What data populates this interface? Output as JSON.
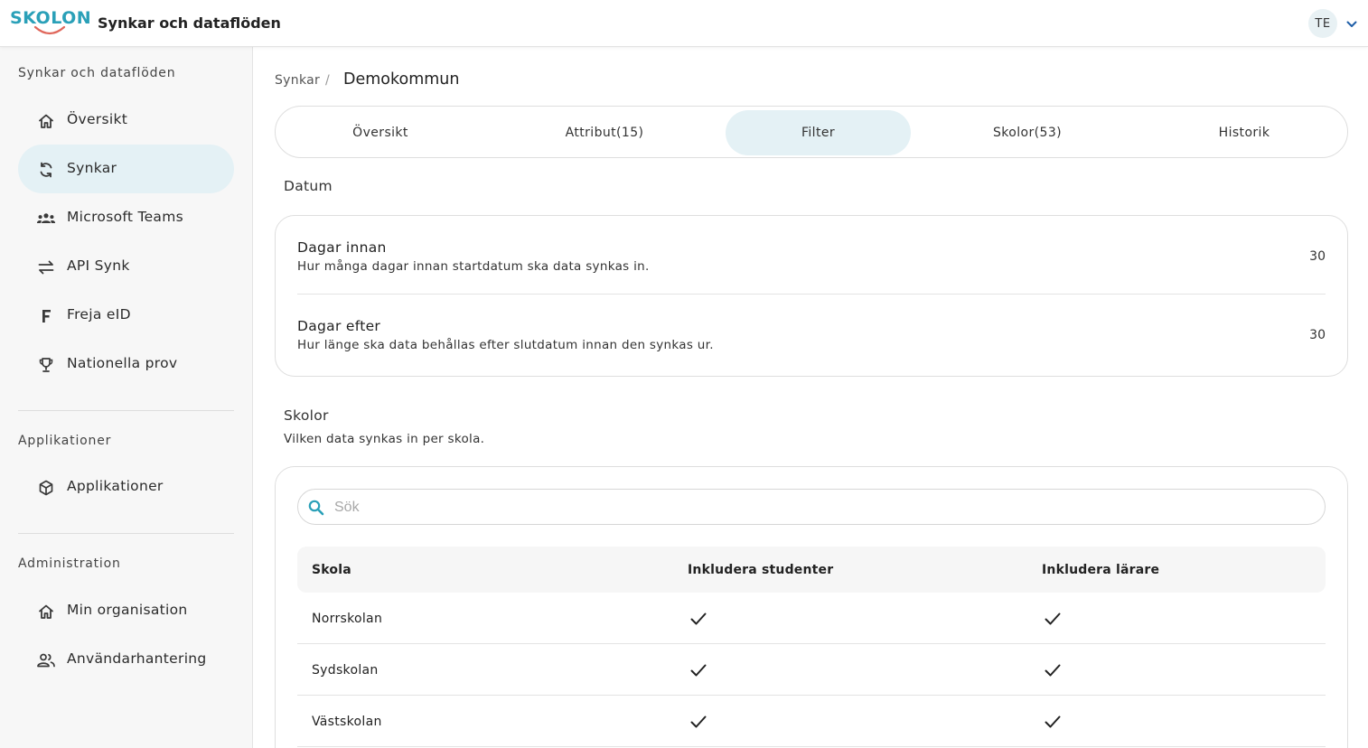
{
  "header": {
    "logo_text": "SKOLON",
    "title": "Synkar och dataflöden",
    "user_initials": "TE",
    "user_menu_icon": "chevron-down-icon"
  },
  "sidebar": {
    "sections": [
      {
        "title": "Synkar och dataflöden",
        "items": [
          {
            "label": "Översikt",
            "icon": "home-icon",
            "active": false
          },
          {
            "label": "Synkar",
            "icon": "sync-icon",
            "active": true
          },
          {
            "label": "Microsoft Teams",
            "icon": "groups-icon",
            "active": false
          },
          {
            "label": "API Synk",
            "icon": "swap-arrows-icon",
            "active": false
          },
          {
            "label": "Freja eID",
            "icon": "freja-icon",
            "active": false
          },
          {
            "label": "Nationella prov",
            "icon": "trophy-icon",
            "active": false
          }
        ]
      },
      {
        "title": "Applikationer",
        "items": [
          {
            "label": "Applikationer",
            "icon": "cube-icon",
            "active": false
          }
        ]
      },
      {
        "title": "Administration",
        "items": [
          {
            "label": "Min organisation",
            "icon": "home-icon",
            "active": false
          },
          {
            "label": "Användarhantering",
            "icon": "people-icon",
            "active": false
          }
        ]
      }
    ]
  },
  "breadcrumb": {
    "root": "Synkar",
    "separator": "/",
    "current": "Demokommun"
  },
  "tabs": [
    {
      "label": "Översikt",
      "active": false
    },
    {
      "label": "Attribut(15)",
      "active": false
    },
    {
      "label": "Filter",
      "active": true
    },
    {
      "label": "Skolor(53)",
      "active": false
    },
    {
      "label": "Historik",
      "active": false
    }
  ],
  "datum": {
    "title": "Datum",
    "settings": [
      {
        "title": "Dagar innan",
        "description": "Hur många dagar innan startdatum ska data synkas in.",
        "value": "30"
      },
      {
        "title": "Dagar efter",
        "description": "Hur länge ska data behållas efter slutdatum innan den synkas ur.",
        "value": "30"
      }
    ]
  },
  "skolor": {
    "title": "Skolor",
    "subtitle": "Vilken data synkas in per skola.",
    "search": {
      "placeholder": "Sök",
      "value": "",
      "icon": "search-icon"
    },
    "columns": [
      "Skola",
      "Inkludera studenter",
      "Inkludera lärare"
    ],
    "rows": [
      {
        "name": "Norrskolan",
        "students": true,
        "teachers": true
      },
      {
        "name": "Sydskolan",
        "students": true,
        "teachers": true
      },
      {
        "name": "Västskolan",
        "students": true,
        "teachers": true
      }
    ]
  },
  "colors": {
    "accent": "#2aa0b8",
    "active_bg": "#e4f1f5",
    "sidebar_bg": "#f7f7f7",
    "logo_smile": "#e0675b"
  }
}
